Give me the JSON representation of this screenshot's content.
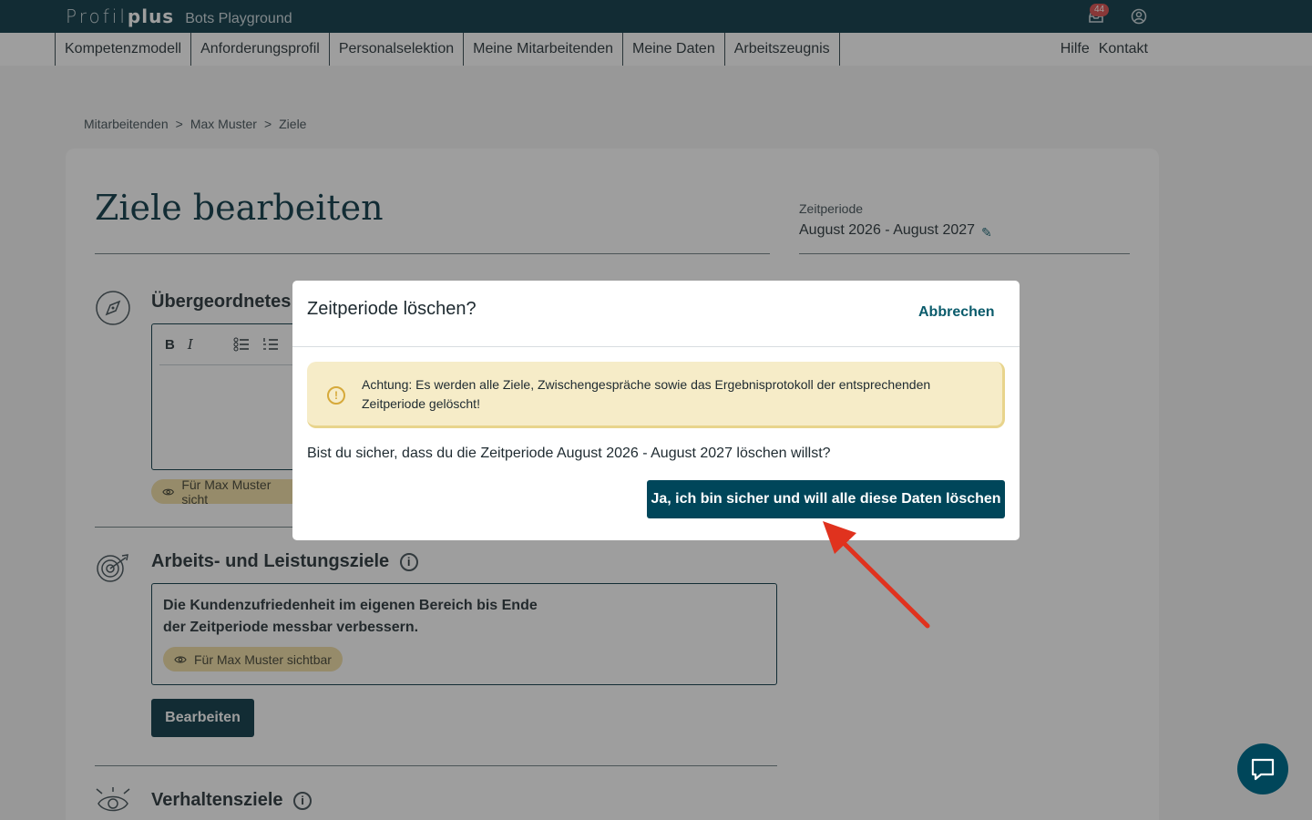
{
  "brand": {
    "name_light": "Profil",
    "name_bold": "plus",
    "workspace": "Bots Playground"
  },
  "topbar": {
    "notification_count": "44",
    "icons": [
      "inbox-icon",
      "user-account-icon"
    ]
  },
  "nav": {
    "items": [
      "Kompetenzmodell",
      "Anforderungsprofil",
      "Personalselektion",
      "Meine Mitarbeitenden",
      "Meine Daten",
      "Arbeitszeugnis"
    ],
    "right": [
      "Hilfe",
      "Kontakt"
    ]
  },
  "breadcrumb": [
    "Mitarbeitenden",
    ">",
    "Max Muster",
    ">",
    "Ziele"
  ],
  "page": {
    "title": "Ziele bearbeiten",
    "zeitperiode_label": "Zeitperiode",
    "zeitperiode_value": "August 2026 - August 2027"
  },
  "sections": {
    "uebergeordnet": {
      "title": "Übergeordnetes Z",
      "visibility": "Für Max Muster sicht"
    },
    "arbeit": {
      "title": "Arbeits- und Leistungsziele",
      "goal_text": "Die Kundenzufriedenheit im eigenen Bereich bis Ende der Zeitperiode messbar verbessern.",
      "visibility": "Für Max Muster sichtbar",
      "edit_label": "Bearbeiten"
    },
    "verhalten": {
      "title": "Verhaltensziele"
    }
  },
  "editor": {
    "bold": "B",
    "italic": "I"
  },
  "modal": {
    "title": "Zeitperiode löschen?",
    "cancel_label": "Abbrechen",
    "warning": "Achtung: Es werden alle Ziele, Zwischengespräche sowie das Ergebnisprotokoll der entsprechenden Zeitperiode gelöscht!",
    "question": "Bist du sicher, dass du die Zeitperiode August 2026 - August 2027 löschen willst?",
    "confirm_label": "Ja, ich bin sicher und will alle diese Daten löschen"
  },
  "colors": {
    "brand_dark": "#00313f",
    "accent": "#00465a",
    "warning_bg": "#f6ecc8",
    "pill_bg": "#f0dca0",
    "arrow": "#e0321e"
  }
}
